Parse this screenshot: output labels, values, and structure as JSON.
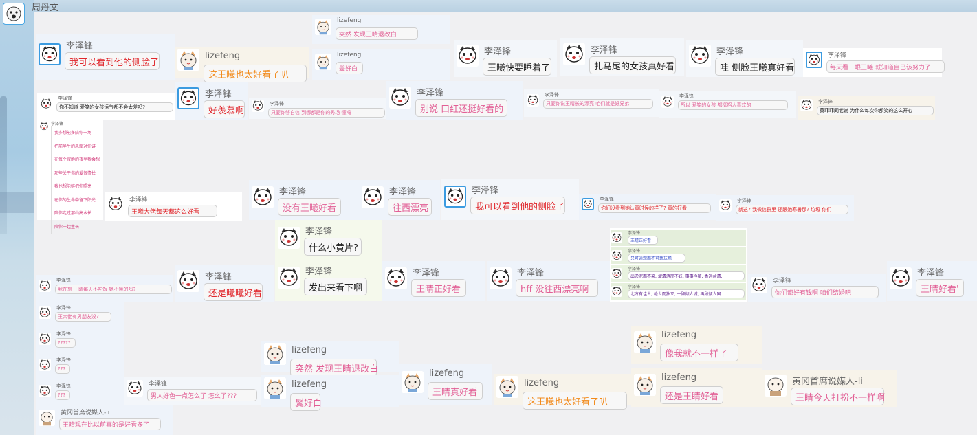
{
  "owner": {
    "name": "周丹文"
  },
  "messages": [
    {
      "id": "m1",
      "sender": "李泽锋",
      "text": "我可以看到他的侧脸了",
      "color": "red"
    },
    {
      "id": "m2",
      "sender": "lizefeng",
      "text": "这王曦也太好看了叭",
      "color": "orange"
    },
    {
      "id": "m3",
      "sender": "lizefeng",
      "text": "突然 发现王睛退改白",
      "color": "pink"
    },
    {
      "id": "m4",
      "sender": "lizefeng",
      "text": "鬓好白",
      "color": "pink"
    },
    {
      "id": "m5",
      "sender": "李泽锋",
      "text": "王曦快要睡着了",
      "color": "black"
    },
    {
      "id": "m6",
      "sender": "李泽锋",
      "text": "扎马尾的女孩真好看",
      "color": "black"
    },
    {
      "id": "m7",
      "sender": "李泽锋",
      "text": "哇 侧脸王曦真好看",
      "color": "black"
    },
    {
      "id": "m8",
      "sender": "李泽锋",
      "text": "每天看一眼王曦 就知道自己该努力了",
      "color": "pink"
    },
    {
      "id": "m9",
      "sender": "李泽锋",
      "text": "你不知道 爱笑的女孩运气都不会太差吗?",
      "color": "black"
    },
    {
      "id": "m10",
      "sender": "李泽锋",
      "text": "好羡慕啊",
      "color": "red"
    },
    {
      "id": "m11",
      "sender": "李泽锋",
      "text": "只要你够自信  到哪都是你的秀场  懂吗",
      "color": "pink"
    },
    {
      "id": "m12",
      "sender": "李泽锋",
      "text": "别说 口红还挺好看的",
      "color": "pink"
    },
    {
      "id": "m13",
      "sender": "李泽锋",
      "text": "只要你说王睛长的漂亮  咱们就是好兄弟",
      "color": "pink"
    },
    {
      "id": "m14",
      "sender": "李泽锋",
      "text": "所以  爱笑的女孩  都挺招人喜欢的",
      "color": "pink"
    },
    {
      "id": "m15",
      "sender": "李泽锋",
      "text": "黄菲菲同老谢 为什么每次你都笑的这么开心",
      "color": "black"
    },
    {
      "id": "m16",
      "sender": "李泽锋",
      "text": "王曦大佬每天都这么好看",
      "color": "red"
    },
    {
      "id": "m17",
      "sender": "李泽锋",
      "text": "没有王曦好看",
      "color": "pink"
    },
    {
      "id": "m18",
      "sender": "李泽锋",
      "text": "往西漂亮",
      "color": "pink"
    },
    {
      "id": "m19",
      "sender": "李泽锋",
      "text": "我可以看到他的侧脸了",
      "color": "red"
    },
    {
      "id": "m20",
      "sender": "李泽锋",
      "text": "你们没看到她认真时候的样子? 真的好看",
      "color": "red"
    },
    {
      "id": "m21",
      "sender": "李泽锋",
      "text": "就这? 我微信群里 还跟她寒暑那? 垃圾 你们",
      "color": "red"
    },
    {
      "id": "m22",
      "sender": "李泽锋",
      "text": "什么小黄片?",
      "color": "black"
    },
    {
      "id": "m23",
      "sender": "李泽锋",
      "text": "发出来看下啊",
      "color": "black"
    },
    {
      "id": "m24",
      "sender": "李泽锋",
      "text": "我在想  王睛每天不吃饭  她不饿的吗?",
      "color": "pink"
    },
    {
      "id": "m25",
      "sender": "李泽锋",
      "text": "还是曦曦好看",
      "color": "red"
    },
    {
      "id": "m26",
      "sender": "李泽锋",
      "text": "王睛正好看",
      "color": "pink"
    },
    {
      "id": "m27",
      "sender": "李泽锋",
      "text": "hff 没往西漂亮啊",
      "color": "pink"
    },
    {
      "id": "m28",
      "sender": "李泽锋",
      "text": "你们都好有钱啊     咱们结婚吧",
      "color": "pink"
    },
    {
      "id": "m29",
      "sender": "李泽锋",
      "text": "王睛好看'",
      "color": "pink"
    },
    {
      "id": "m30",
      "sender": "李泽锋",
      "text": "王大佬有男朋友没?",
      "color": "pink"
    },
    {
      "id": "m31",
      "sender": "李泽锋",
      "text": "?????",
      "color": "pink"
    },
    {
      "id": "m32",
      "sender": "李泽锋",
      "text": "???",
      "color": "pink"
    },
    {
      "id": "m33",
      "sender": "李泽锋",
      "text": "???",
      "color": "pink"
    },
    {
      "id": "m34",
      "sender": "李泽锋",
      "text": "男人好色一点怎么了  怎么了???",
      "color": "pink"
    },
    {
      "id": "m35",
      "sender": "lizefeng",
      "text": "突然 发现王睛退改白",
      "color": "pink"
    },
    {
      "id": "m36",
      "sender": "lizefeng",
      "text": "鬓好白",
      "color": "pink"
    },
    {
      "id": "m37",
      "sender": "lizefeng",
      "text": "王睛真好看",
      "color": "pink"
    },
    {
      "id": "m38",
      "sender": "lizefeng",
      "text": "这王曦也太好看了叭",
      "color": "orange"
    },
    {
      "id": "m39",
      "sender": "lizefeng",
      "text": "像我就不一样了",
      "color": "pink"
    },
    {
      "id": "m40",
      "sender": "lizefeng",
      "text": "还是王睛好看",
      "color": "pink"
    },
    {
      "id": "m41",
      "sender": "黄冈首席说媒人-li",
      "text": "王睛今天打扮不一样啊",
      "color": "pink"
    },
    {
      "id": "m42",
      "sender": "黄冈首席说媒人-li",
      "text": "王睛现在比以前真的是好看多了",
      "color": "pink"
    }
  ],
  "poem": {
    "sender": "李泽锋",
    "lines": [
      "我多想能多陪你一场",
      "把前半生的风霜对你讲",
      "在每个寂静的夜里我会想",
      "那些关于你的爱恨情长",
      "我也想能够把你照亮",
      "在你的生命中留下阳光",
      "陪你走过那山高水长",
      "陪你一起生长"
    ]
  },
  "stack": {
    "items": [
      {
        "sender": "李泽锋",
        "text": "王睛正好看",
        "color": "blue"
      },
      {
        "sender": "李泽锋",
        "text": "只可远观而不可亵玩焉",
        "color": "blue"
      },
      {
        "sender": "李泽锋",
        "text": "出淤泥而不染, 濯清涟而不妖, 事事净植, 香远益清,",
        "color": "purple"
      },
      {
        "sender": "李泽锋",
        "text": "北方有佳人, 绝世而独立, 一顾倾人城, 再顾倾人国",
        "color": "purple"
      }
    ]
  }
}
